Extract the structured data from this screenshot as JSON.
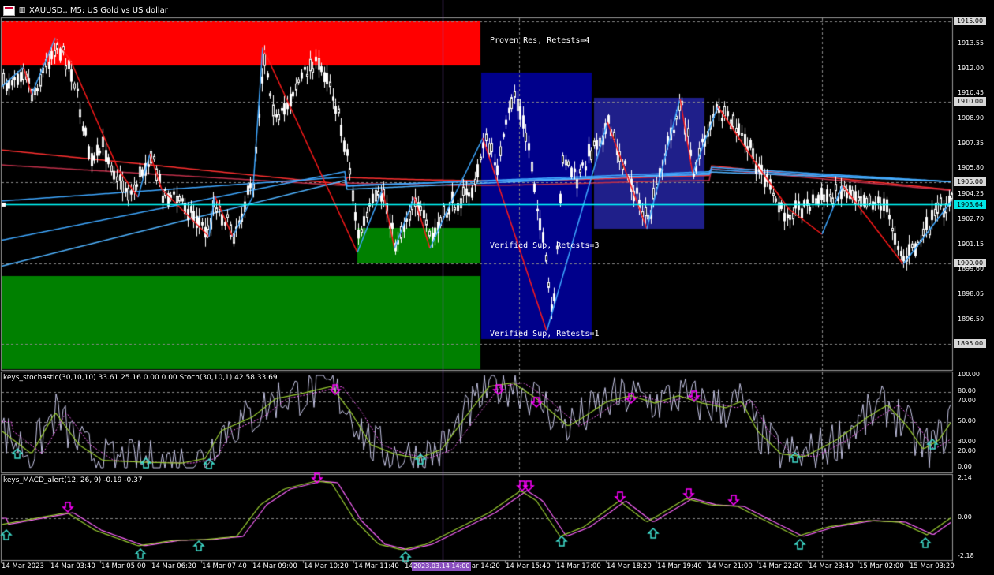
{
  "window": {
    "title": "XAUUSD., M5:  US Gold vs US dollar",
    "symbol": "XAUUSD.",
    "timeframe": "M5",
    "description": "US Gold vs US dollar"
  },
  "colors": {
    "background": "#000000",
    "bull_candle": "#ffffff",
    "grid": "#6a6a6a",
    "resistance_zone": "#ff0000",
    "support_zone": "#008000",
    "verified_box": "#00008b",
    "current_price_line": "#00ffff",
    "zigzag_down": "#ff1a1a",
    "zigzag_up": "#3ea7ff",
    "stoch_main": "#9acd32",
    "macd_main": "#9acd32",
    "macd_signal": "#ff66ff",
    "arrow_up": "#40e0d0",
    "arrow_down": "#ff00ff",
    "cursor_line": "#8a4fbf"
  },
  "zones": {
    "proven_res_label": "Proven Res, Retests=4",
    "verified_sup_label_1": "Verified Sup, Retests=3",
    "verified_sup_label_2": "Verified Sup, Retests=1"
  },
  "price_axis": {
    "labels": [
      "1915.00",
      "1913.55",
      "1912.00",
      "1910.45",
      "1910.00",
      "1908.90",
      "1907.35",
      "1905.80",
      "1905.00",
      "1904.25",
      "1903.64",
      "1902.70",
      "1901.15",
      "1900.00",
      "1899.60",
      "1898.05",
      "1896.50",
      "1895.00"
    ],
    "current_price": "1903.64",
    "boxed": [
      "1915.00",
      "1910.00",
      "1905.00",
      "1900.00",
      "1895.00"
    ]
  },
  "stoch_panel": {
    "label": "keys_stochastic(30,10,10) 33.61 25.16 0.00 0.00 Stoch(30,10,1) 42.58 33.69",
    "levels": [
      "100.00",
      "80.00",
      "70.00",
      "50.00",
      "30.00",
      "20.00",
      "0.00"
    ]
  },
  "macd_panel": {
    "label": "keys_MACD_alert(12, 26, 9) -0.19 -0.37",
    "levels": [
      "2.14",
      "0.00",
      "-2.18"
    ]
  },
  "time_axis": {
    "labels": [
      "14 Mar 2023",
      "14 Mar 03:40",
      "14 Mar 05:00",
      "14 Mar 06:20",
      "14 Mar 07:40",
      "14 Mar 09:00",
      "14 Mar 10:20",
      "14 Mar 11:40",
      "14 Mar 13:00",
      "14 Mar 14:20",
      "14 Mar 15:40",
      "14 Mar 17:00",
      "14 Mar 18:20",
      "14 Mar 19:40",
      "14 Mar 21:00",
      "14 Mar 22:20",
      "14 Mar 23:40",
      "15 Mar 02:00",
      "15 Mar 03:20"
    ],
    "cursor_label": "2023.03.14 14:00"
  }
}
